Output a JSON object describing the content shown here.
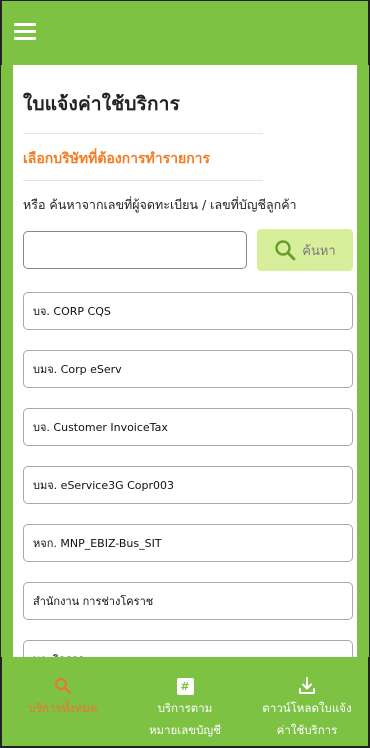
{
  "header": {
    "menu_icon": "hamburger-menu-icon"
  },
  "page": {
    "title": "ใบแจ้งค่าใช้บริการ",
    "section_label": "เลือกบริษัทที่ต้องการทำรายการ",
    "hint": "หรือ ค้นหาจากเลขที่ผู้จดทะเบียน / เลขที่บัญชีลูกค้า"
  },
  "search": {
    "value": "",
    "placeholder": "",
    "button_label": "ค้นหา",
    "icon": "search-icon"
  },
  "companies": [
    {
      "label": "บจ. CORP CQS"
    },
    {
      "label": "บมจ. Corp eServ"
    },
    {
      "label": "บจ. Customer InvoiceTax"
    },
    {
      "label": "บมจ. eService3G Copr003"
    },
    {
      "label": "หจก. MNP_EBIZ-Bus_SIT"
    },
    {
      "label": "สำนักงาน การช่างโคราช"
    },
    {
      "label": "บง. กิจการ"
    }
  ],
  "bottom_tabs": [
    {
      "label_line1": "บริการทั้งหมด",
      "label_line2": "",
      "icon": "search-icon",
      "active": true
    },
    {
      "label_line1": "บริการตาม",
      "label_line2": "หมายเลขบัญชี",
      "icon": "hash-icon",
      "active": false
    },
    {
      "label_line1": "ดาวน์โหลดใบแจ้ง",
      "label_line2": "ค่าใช้บริการ",
      "icon": "download-icon",
      "active": false
    }
  ],
  "colors": {
    "brand_green": "#7dc243",
    "accent_orange": "#f47b20",
    "search_button_bg": "#d7ee9a"
  }
}
